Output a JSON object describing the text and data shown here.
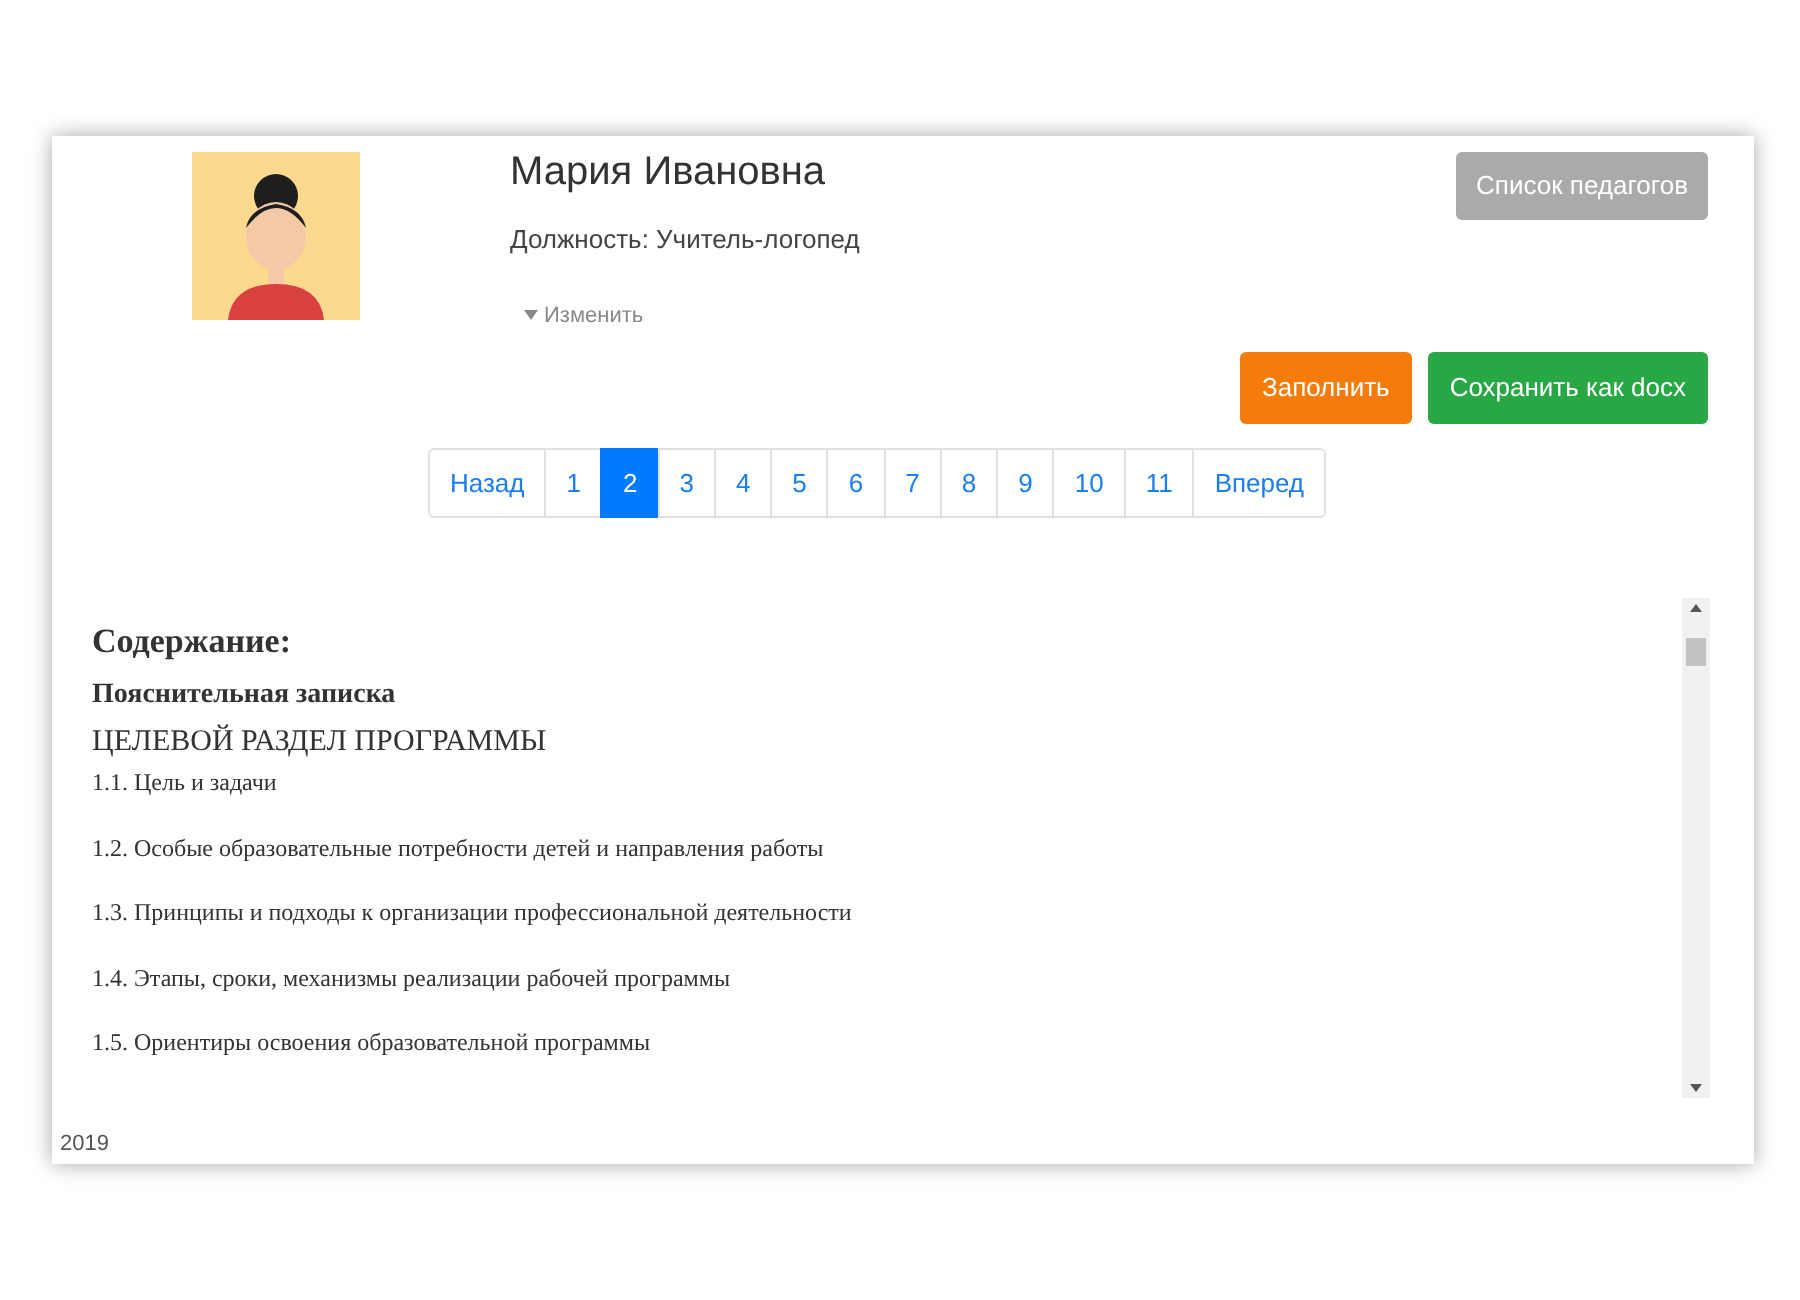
{
  "profile": {
    "name": "Мария Ивановна",
    "position": "Должность: Учитель-логопед",
    "edit_link": "Изменить"
  },
  "buttons": [
    {
      "label": "Список педагогов",
      "kind": "secondary"
    },
    {
      "label": "Заполнить",
      "kind": "fill"
    },
    {
      "label": "Сохранить как docx",
      "kind": "save"
    }
  ],
  "pagination": [
    {
      "label": "Назад",
      "selected": false
    },
    {
      "label": "1",
      "selected": false
    },
    {
      "label": "2",
      "selected": true
    },
    {
      "label": "3",
      "selected": false
    },
    {
      "label": "4",
      "selected": false
    },
    {
      "label": "5",
      "selected": false
    },
    {
      "label": "6",
      "selected": false
    },
    {
      "label": "7",
      "selected": false
    },
    {
      "label": "8",
      "selected": false
    },
    {
      "label": "9",
      "selected": false
    },
    {
      "label": "10",
      "selected": false
    },
    {
      "label": "11",
      "selected": false
    },
    {
      "label": "Вперед",
      "selected": false
    }
  ],
  "document": [
    {
      "kind": "title",
      "text": "Содержание:"
    },
    {
      "kind": "heading",
      "text": "Пояснительная записка"
    },
    {
      "kind": "section",
      "text": "ЦЕЛЕВОЙ РАЗДЕЛ ПРОГРАММЫ"
    },
    {
      "kind": "item",
      "text": "1.1. Цель и задачи"
    },
    {
      "kind": "item",
      "text": "1.2. Особые образовательные потребности детей и направления работы"
    },
    {
      "kind": "item",
      "text": "1.3. Принципы и подходы к организации профессиональной деятельности"
    },
    {
      "kind": "item",
      "text": "1.4. Этапы, сроки, механизмы реализации рабочей программы"
    },
    {
      "kind": "item",
      "text": "1.5. Ориентиры освоения образовательной программы"
    }
  ],
  "footer": "2019"
}
